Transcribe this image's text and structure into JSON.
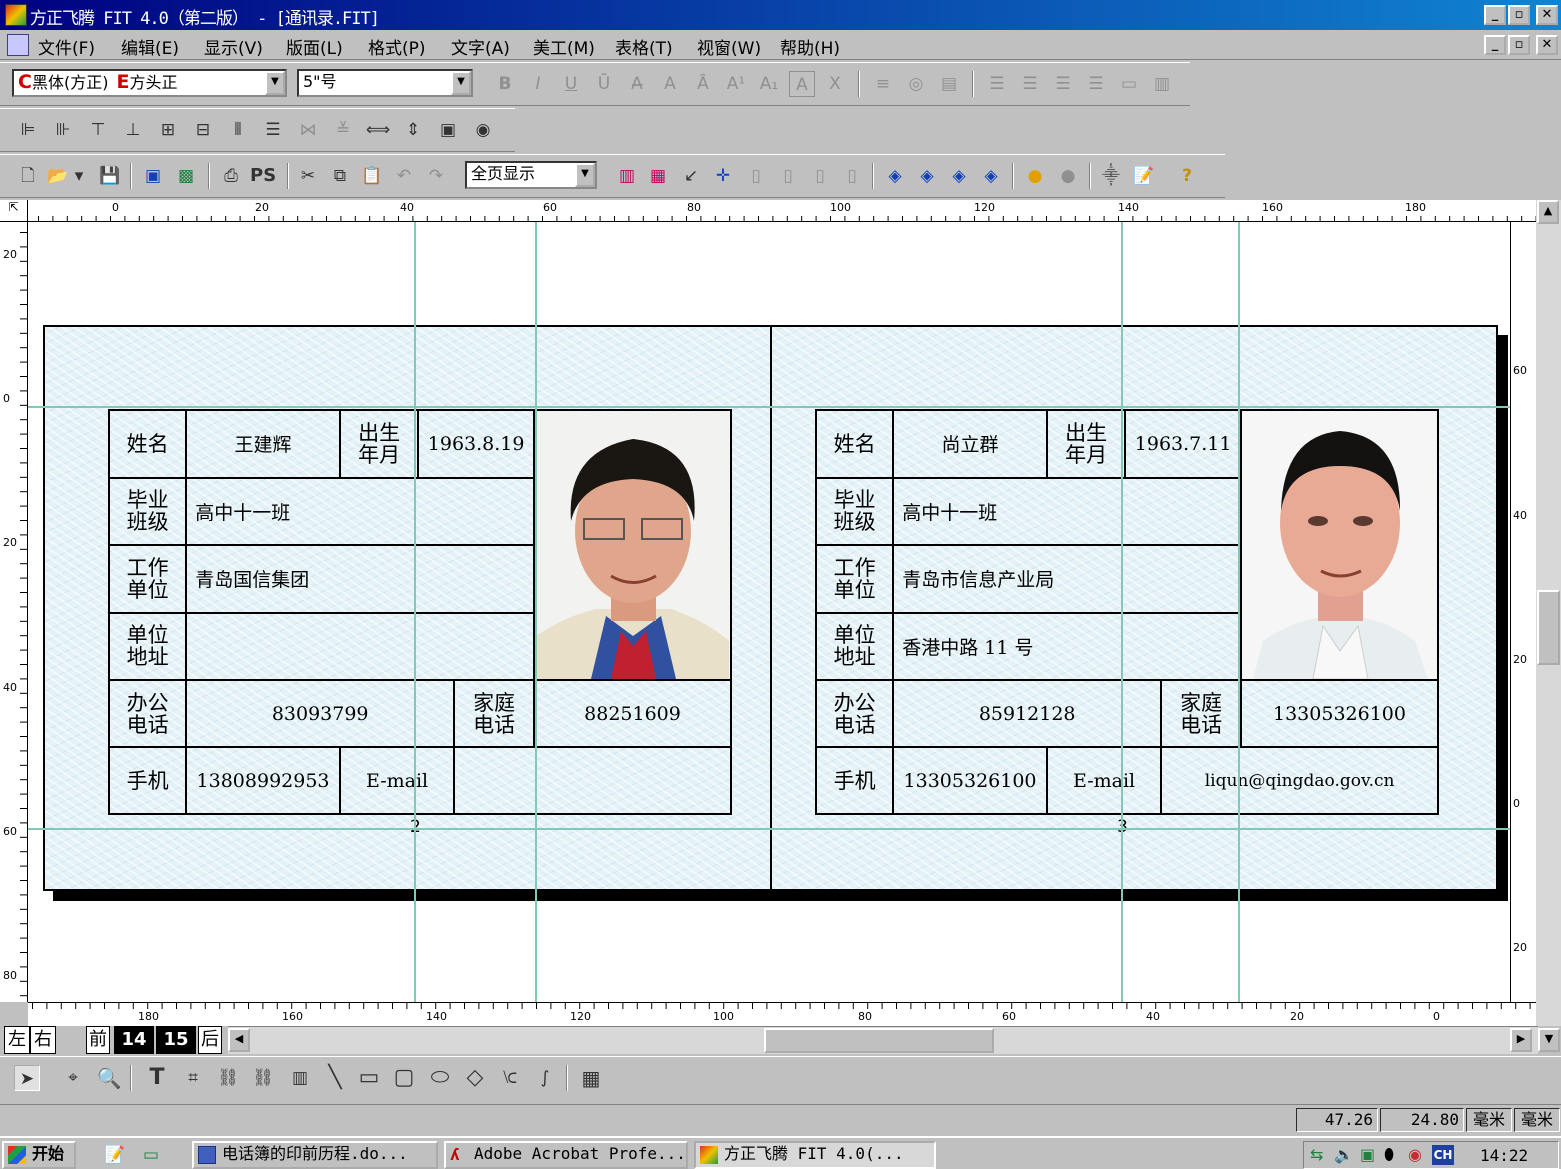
{
  "window": {
    "title": "方正飞腾 FIT 4.0（第二版） - [通讯录.FIT]",
    "min": "_",
    "max": "▫",
    "close": "✕"
  },
  "menu": [
    "文件(F)",
    "编辑(E)",
    "显示(V)",
    "版面(L)",
    "格式(P)",
    "文字(A)",
    "美工(M)",
    "表格(T)",
    "视窗(W)",
    "帮助(H)"
  ],
  "format_toolbar": {
    "font_c_prefix": "C",
    "font_c": "黑体(方正)",
    "font_e_prefix": "E",
    "font_e": "方头正",
    "size": "5\"号",
    "style_buttons": [
      "B",
      "I",
      "U",
      "Ū",
      "A̶",
      "A",
      "Ȃ",
      "A¹",
      "A₁",
      "A",
      "X"
    ]
  },
  "main_toolbar": {
    "zoom": "全页显示",
    "ps_label": "PS"
  },
  "ruler_top": [
    "0",
    "20",
    "40",
    "60",
    "80",
    "100",
    "120",
    "140",
    "160",
    "180"
  ],
  "ruler_left": [
    "20",
    "0",
    "20",
    "40",
    "60",
    "80"
  ],
  "ruler_right": [
    "60",
    "40",
    "20",
    "0",
    "20"
  ],
  "ruler_bottom": [
    "180",
    "160",
    "140",
    "120",
    "100",
    "80",
    "60",
    "40",
    "20",
    "0"
  ],
  "cards": [
    {
      "name_label": "姓名",
      "name": "王建辉",
      "birth_label": "出生\n年月",
      "birth": "1963.8.19",
      "class_label": "毕业\n班级",
      "class": "高中十一班",
      "work_label": "工作\n单位",
      "work": "青岛国信集团",
      "addr_label": "单位\n地址",
      "addr": "",
      "office_label": "办公\n电话",
      "office": "83093799",
      "home_label": "家庭\n电话",
      "home": "88251609",
      "mobile_label": "手机",
      "mobile": "13808992953",
      "email_label": "E-mail",
      "email": "",
      "page_number": "2"
    },
    {
      "name_label": "姓名",
      "name": "尚立群",
      "birth_label": "出生\n年月",
      "birth": "1963.7.11",
      "class_label": "毕业\n班级",
      "class": "高中十一班",
      "work_label": "工作\n单位",
      "work": "青岛市信息产业局",
      "addr_label": "单位\n地址",
      "addr": "香港中路 11 号",
      "office_label": "办公\n电话",
      "office": "85912128",
      "home_label": "家庭\n电话",
      "home": "13305326100",
      "mobile_label": "手机",
      "mobile": "13305326100",
      "email_label": "E-mail",
      "email": "liqun@qingdao.gov.cn",
      "page_number": "3"
    }
  ],
  "page_nav": {
    "left": "左",
    "right": "右",
    "prev": "前",
    "page_a": "14",
    "page_b": "15",
    "next": "后"
  },
  "status": {
    "x": "47.26",
    "y": "24.80",
    "unit1": "毫米",
    "unit2": "毫米"
  },
  "taskbar": {
    "start": "开始",
    "tasks": [
      "电话簿的印前历程.do...",
      "Adobe Acrobat Profe...",
      "方正飞腾 FIT 4.0(..."
    ],
    "ime": "CH",
    "clock": "14:22"
  }
}
